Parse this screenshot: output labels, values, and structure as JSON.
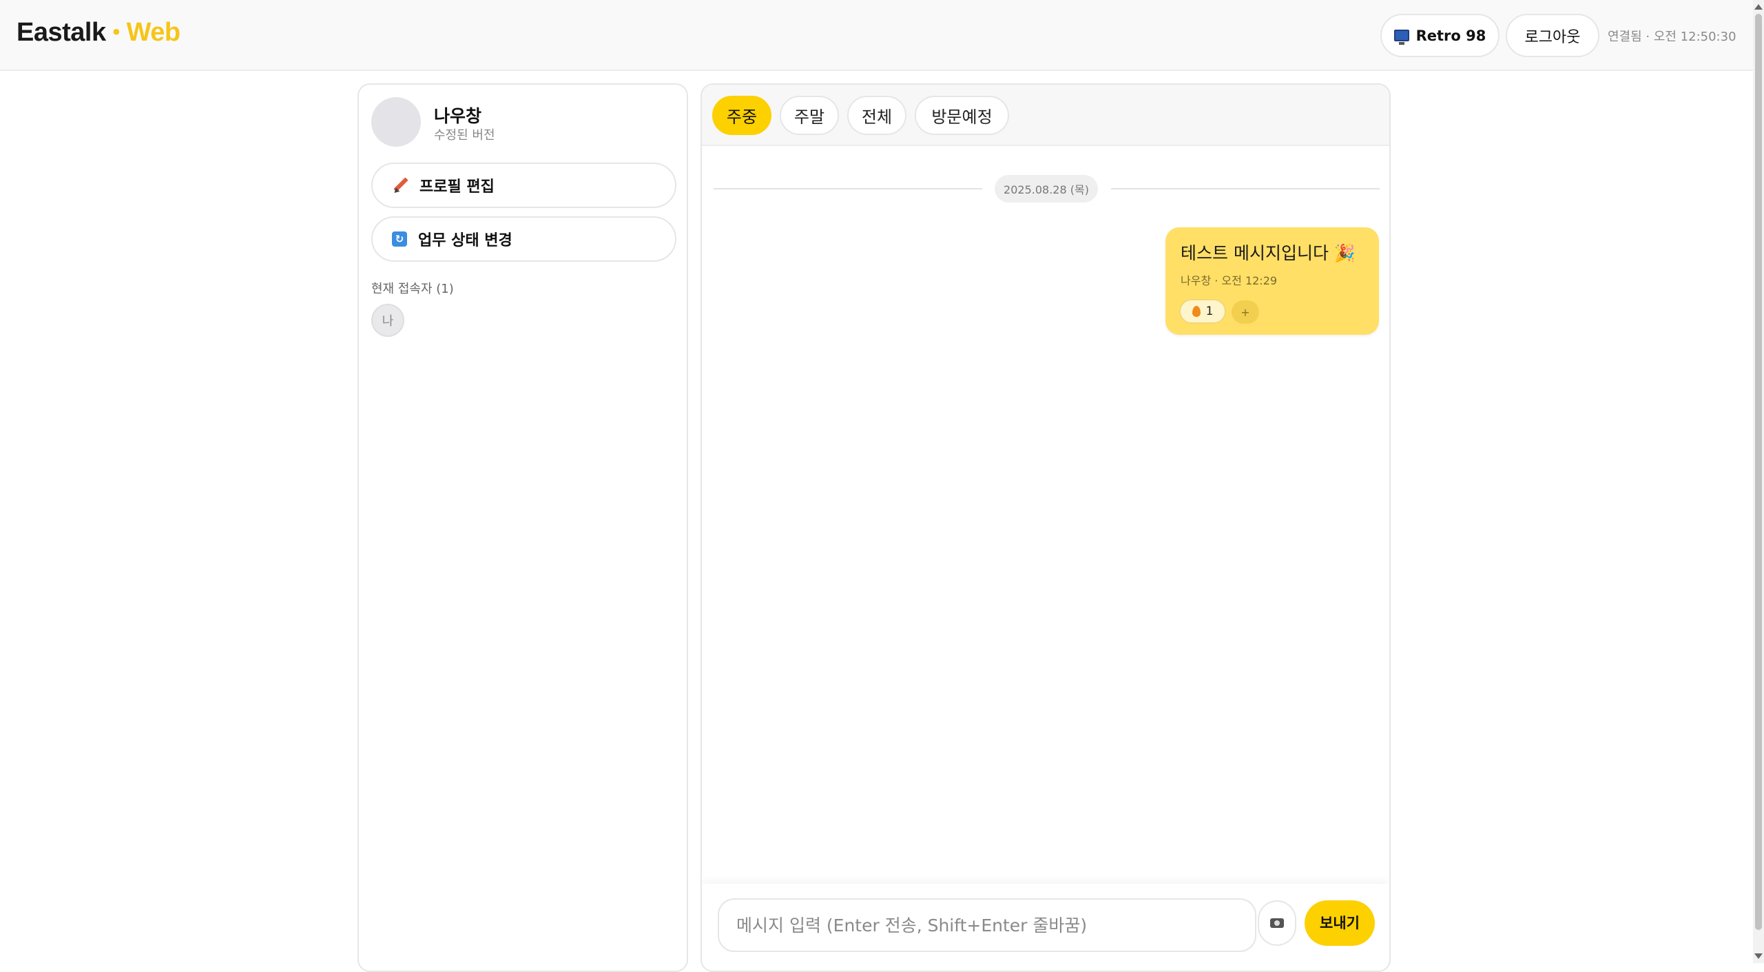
{
  "header": {
    "brand_main": "Eastalk",
    "brand_dot": "•",
    "brand_accent": "Web",
    "retro_label": "Retro 98",
    "logout_label": "로그아웃",
    "status": "연결됨 · 오전 12:50:30"
  },
  "sidebar": {
    "name": "나우창",
    "subtitle": "수정된 버전",
    "edit_profile": "프로필 편집",
    "change_status": "업무 상태 변경",
    "online_label": "현재 접속자 (1)",
    "online_users": [
      "나"
    ]
  },
  "chat": {
    "tabs": [
      {
        "label": "주중",
        "active": true
      },
      {
        "label": "주말",
        "active": false
      },
      {
        "label": "전체",
        "active": false
      },
      {
        "label": "방문예정",
        "active": false
      }
    ],
    "date_divider": "2025.08.28 (목)",
    "messages": [
      {
        "text": "테스트 메시지입니다 🎉",
        "meta": "나우창 · 오전 12:29",
        "reaction_count": "1",
        "add_reaction": "+"
      }
    ],
    "composer": {
      "placeholder": "메시지 입력 (Enter 전송, Shift+Enter 줄바꿈)",
      "send_label": "보내기"
    }
  },
  "icons": {
    "retro": "monitor-icon",
    "edit": "pencil-icon",
    "status": "refresh-icon",
    "reaction": "fire-icon",
    "attach": "camera-icon"
  },
  "colors": {
    "accent": "#fdd000",
    "bubble": "#ffdf66"
  }
}
